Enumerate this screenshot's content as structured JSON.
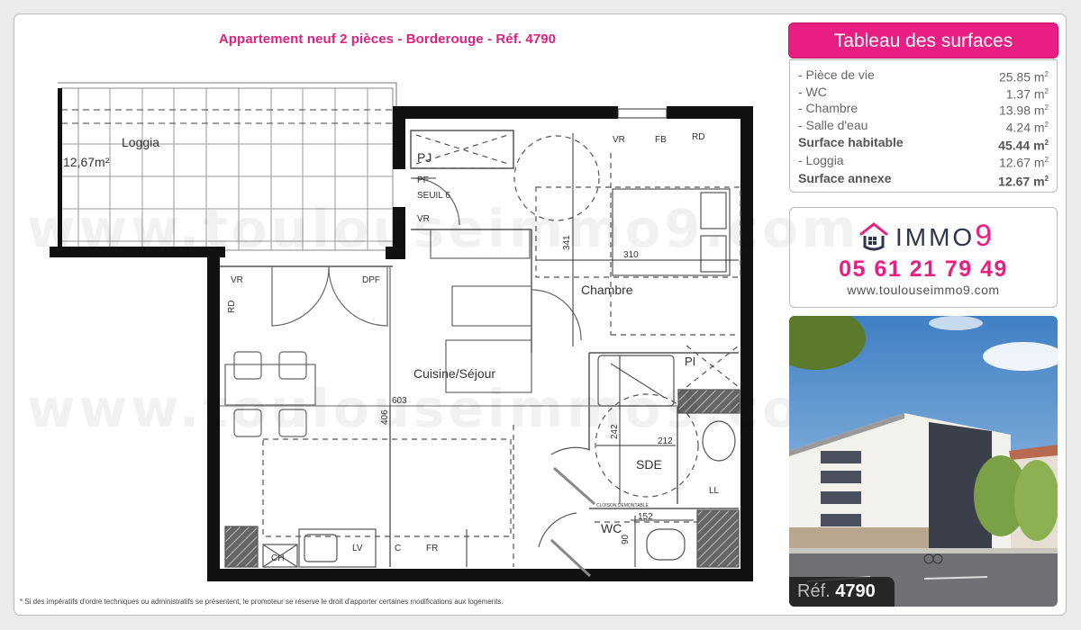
{
  "title": "Appartement neuf 2 pièces - Borderouge - Réf. 4790",
  "watermark": "www.toulouseimmo9.com",
  "floorplan": {
    "rooms": {
      "loggia": "Loggia",
      "loggia_area": "12,67m²",
      "cuisine_sejour": "Cuisine/Séjour",
      "chambre": "Chambre",
      "sde": "SDE",
      "wc": "WC"
    },
    "labels": {
      "pj": "PJ",
      "pf": "PF",
      "seuil": "SEUIL 6",
      "vr_entry": "VR",
      "vr_bedroom": "VR",
      "fb": "FB",
      "rd_bedroom": "RD",
      "vr_living": "VR",
      "dpf": "DPF",
      "rd_living": "RD",
      "pl": "PI",
      "ll": "LL",
      "ch": "CH",
      "lv": "LV",
      "c": "C",
      "fr": "FR",
      "cloison": "CLOISON DEMONTABLE"
    },
    "dimensions": {
      "d341": "341",
      "d310": "310",
      "d603": "603",
      "d406": "406",
      "d242": "242",
      "d212": "212",
      "d152": "152",
      "d90": "90"
    }
  },
  "disclaimer": "* Si des impératifs d'ordre techniques ou administratifs se présentent, le promoteur se réserve le droit d'apporter certaines modifications aux logements.",
  "surfaces": {
    "header": "Tableau des surfaces",
    "rows": [
      {
        "label": "- Pièce de vie",
        "value": "25.85 m",
        "bold": false
      },
      {
        "label": "- WC",
        "value": "1.37 m",
        "bold": false
      },
      {
        "label": "- Chambre",
        "value": "13.98 m",
        "bold": false
      },
      {
        "label": "- Salle d'eau",
        "value": "4.24 m",
        "bold": false
      },
      {
        "label": "Surface habitable",
        "value": "45.44 m",
        "bold": true
      },
      {
        "label": "- Loggia",
        "value": "12.67 m",
        "bold": false
      },
      {
        "label": "Surface annexe",
        "value": "12.67 m",
        "bold": true
      }
    ],
    "unit_sup": "2"
  },
  "contact": {
    "brand": "IMMO",
    "brand_nine": "9",
    "phone": "05 61 21 79 49",
    "website": "www.toulouseimmo9.com"
  },
  "photo": {
    "ref_label": "Réf.",
    "ref_number": "4790"
  },
  "colors": {
    "accent": "#e91e83",
    "brand_dark": "#2c3650"
  }
}
